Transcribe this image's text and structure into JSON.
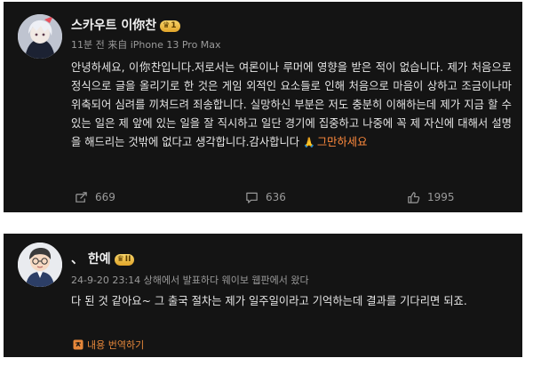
{
  "post1": {
    "username": "스카우트 이你찬",
    "badge_level": "1",
    "meta": "11분 전 来自 iPhone 13 Pro Max",
    "body_text": "안녕하세요, 이你찬입니다.저로서는 여론이나 루머에 영향을 받은 적이 없습니다. 제가 처음으로 정식으로 글을 올리기로 한 것은 게임 외적인 요소들로 인해 처음으로 마음이 상하고 조금이나마 위축되어 심려를 끼쳐드려 죄송합니다. 실망하신 부분은 저도 충분히 이해하는데 제가 지금 할 수 있는 일은 제 앞에 있는 일을 잘 직시하고 일단 경기에 집중하고 나중에 꼭 제 자신에 대해서 설명을 해드리는 것밖에 없다고 생각합니다.감사합니다",
    "emoji_icon": "praying-hands",
    "emphasis_text": "그만하세요",
    "repost_count": "669",
    "comment_count": "636",
    "like_count": "1995"
  },
  "post2": {
    "username": "、 한예",
    "badge_level": "II",
    "meta": "24-9-20 23:14 상해에서 발표하다 웨이보 웹판에서 왔다",
    "body_text": "다 된 것 같아요~ 그 출국 절차는 제가 일주일이라고 기억하는데 결과를 기다리면 되죠.",
    "translate_label": "내용 번역하기"
  },
  "colors": {
    "card_bg": "#141414",
    "accent_orange": "#ff8a3d",
    "badge_gold": "#f0c14a"
  }
}
